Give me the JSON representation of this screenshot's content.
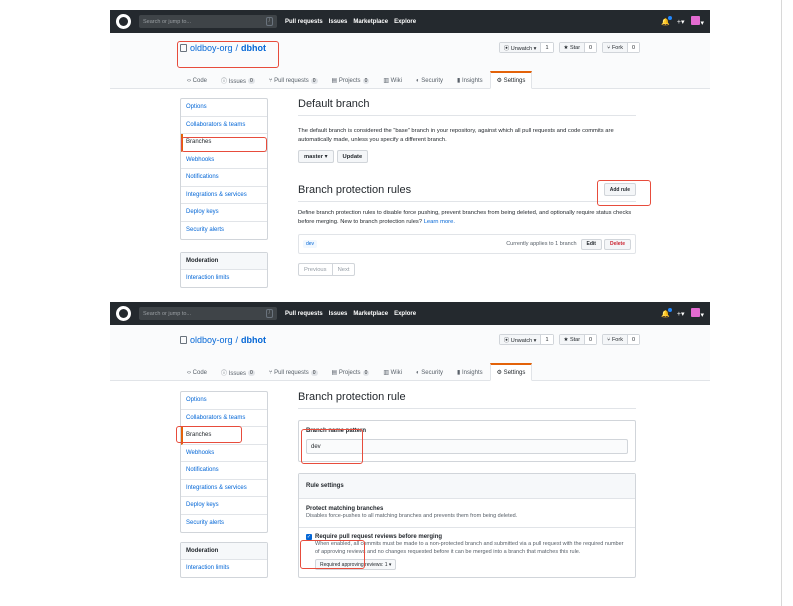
{
  "topbar": {
    "search_placeholder": "Search or jump to...",
    "search_key": "/",
    "nav": [
      "Pull requests",
      "Issues",
      "Marketplace",
      "Explore"
    ],
    "plus": "+▾",
    "avatar_chevron": "▾"
  },
  "repo": {
    "owner": "oldboy-org",
    "separator": "/",
    "name": "dbhot",
    "watch_label": "⦿ Unwatch ▾",
    "watch_count": "1",
    "star_label": "★ Star",
    "star_count": "0",
    "fork_label": "⑂ Fork",
    "fork_count": "0"
  },
  "tabs": [
    {
      "label": "‹› Code",
      "count": ""
    },
    {
      "label": "ⓘ Issues",
      "count": "0"
    },
    {
      "label": "⑂ Pull requests",
      "count": "0"
    },
    {
      "label": "▤ Projects",
      "count": "0"
    },
    {
      "label": "▥ Wiki",
      "count": ""
    },
    {
      "label": "◐ Security",
      "count": ""
    },
    {
      "label": "▮ Insights",
      "count": ""
    },
    {
      "label": "⚙ Settings",
      "count": ""
    }
  ],
  "sidebar": {
    "items": [
      "Options",
      "Collaborators & teams",
      "Branches",
      "Webhooks",
      "Notifications",
      "Integrations & services",
      "Deploy keys",
      "Security alerts"
    ],
    "moderation_head": "Moderation",
    "moderation_item": "Interaction limits"
  },
  "page1": {
    "default_branch_title": "Default branch",
    "default_branch_desc": "The default branch is considered the “base” branch in your repository, against which all pull requests and code commits are automatically made, unless you specify a different branch.",
    "branch_select": "master ▾",
    "update_button": "Update",
    "protection_title": "Branch protection rules",
    "add_rule_button": "Add rule",
    "protection_desc": "Define branch protection rules to disable force pushing, prevent branches from being deleted, and optionally require status checks before merging. New to branch protection rules?",
    "learn_more": "Learn more.",
    "rule_tag": "dev",
    "rule_applies": "Currently applies to 1 branch",
    "edit_button": "Edit",
    "delete_button": "Delete",
    "prev_button": "Previous",
    "next_button": "Next"
  },
  "page2": {
    "title": "Branch protection rule",
    "pattern_label": "Branch name pattern",
    "pattern_value": "dev",
    "rule_settings": "Rule settings",
    "protect_title": "Protect matching branches",
    "protect_desc": "Disables force-pushes to all matching branches and prevents them from being deleted.",
    "require_reviews_label": "Require pull request reviews before merging",
    "require_reviews_desc": "When enabled, all commits must be made to a non-protected branch and submitted via a pull request with the required number of approving reviews and no changes requested before it can be merged into a branch that matches this rule.",
    "approving_reviews_select": "Required approving reviews: 1 ▾"
  },
  "colors": {
    "accent": "#e36209",
    "link": "#0366d6",
    "highlight": "#e74c3c",
    "topbar": "#24292e"
  }
}
